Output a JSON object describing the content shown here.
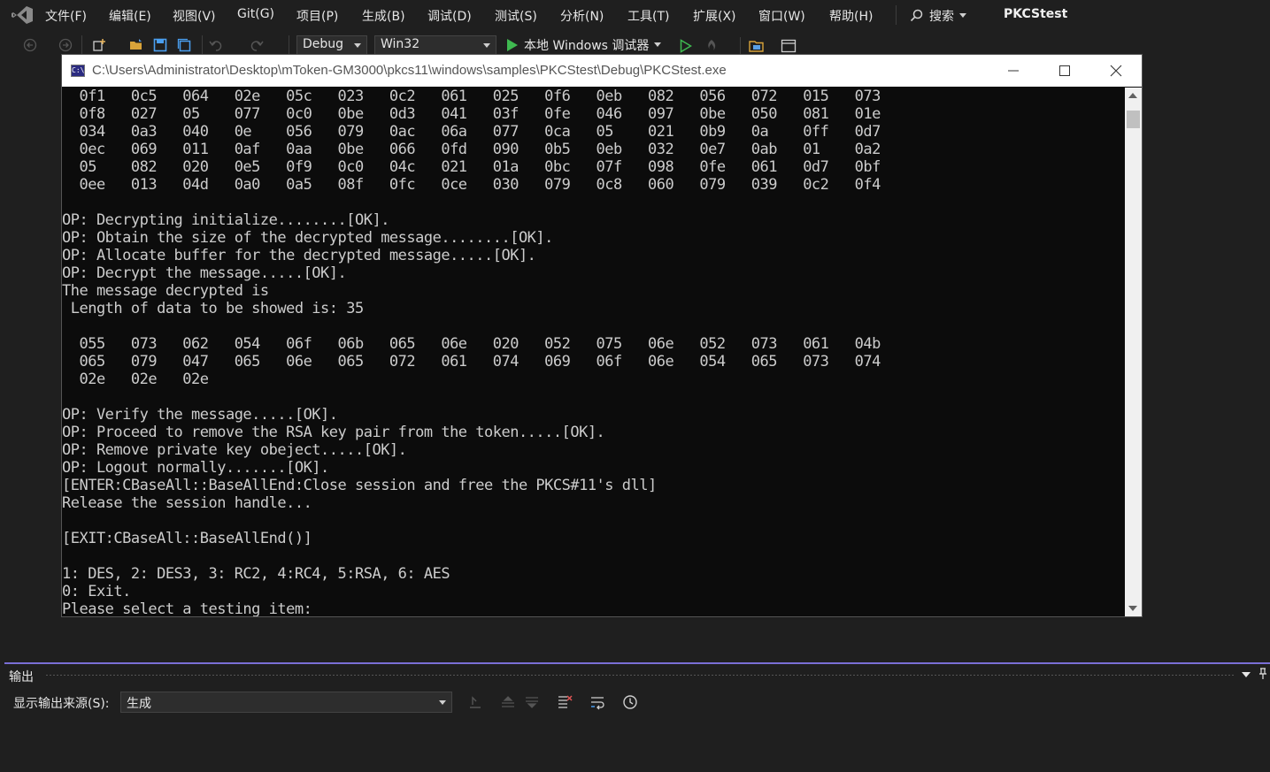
{
  "menu": {
    "items": [
      "文件(F)",
      "编辑(E)",
      "视图(V)",
      "Git(G)",
      "项目(P)",
      "生成(B)",
      "调试(D)",
      "测试(S)",
      "分析(N)",
      "工具(T)",
      "扩展(X)",
      "窗口(W)",
      "帮助(H)"
    ],
    "search_label": "搜索",
    "app_title": "PKCStest"
  },
  "toolbar": {
    "config": "Debug",
    "platform": "Win32",
    "run_label": "本地 Windows 调试器"
  },
  "console": {
    "title": "C:\\Users\\Administrator\\Desktop\\mToken-GM3000\\pkcs11\\windows\\samples\\PKCStest\\Debug\\PKCStest.exe",
    "lines": [
      "  0f1   0c5   064   02e   05c   023   0c2   061   025   0f6   0eb   082   056   072   015   073",
      "  0f8   027   05    077   0c0   0be   0d3   041   03f   0fe   046   097   0be   050   081   01e",
      "  034   0a3   040   0e    056   079   0ac   06a   077   0ca   05    021   0b9   0a    0ff   0d7",
      "  0ec   069   011   0af   0aa   0be   066   0fd   090   0b5   0eb   032   0e7   0ab   01    0a2",
      "  05    082   020   0e5   0f9   0c0   04c   021   01a   0bc   07f   098   0fe   061   0d7   0bf",
      "  0ee   013   04d   0a0   0a5   08f   0fc   0ce   030   079   0c8   060   079   039   0c2   0f4",
      "",
      "OP: Decrypting initialize........[OK].",
      "OP: Obtain the size of the decrypted message........[OK].",
      "OP: Allocate buffer for the decrypted message.....[OK].",
      "OP: Decrypt the message.....[OK].",
      "The message decrypted is",
      " Length of data to be showed is: 35",
      "",
      "  055   073   062   054   06f   06b   065   06e   020   052   075   06e   052   073   061   04b",
      "  065   079   047   065   06e   065   072   061   074   069   06f   06e   054   065   073   074",
      "  02e   02e   02e",
      "",
      "OP: Verify the message.....[OK].",
      "OP: Proceed to remove the RSA key pair from the token.....[OK].",
      "OP: Remove private key obeject.....[OK].",
      "OP: Logout normally.......[OK].",
      "[ENTER:CBaseAll::BaseAllEnd:Close session and free the PKCS#11's dll]",
      "Release the session handle...",
      "",
      "[EXIT:CBaseAll::BaseAllEnd()]",
      "",
      "1: DES, 2: DES3, 3: RC2, 4:RC4, 5:RSA, 6: AES",
      "0: Exit.",
      "Please select a testing item:"
    ]
  },
  "output": {
    "title": "输出",
    "source_label": "显示输出来源(S):",
    "source_value": "生成"
  },
  "colors": {
    "accent": "#7a6fd6",
    "run_green": "#3fb950"
  }
}
